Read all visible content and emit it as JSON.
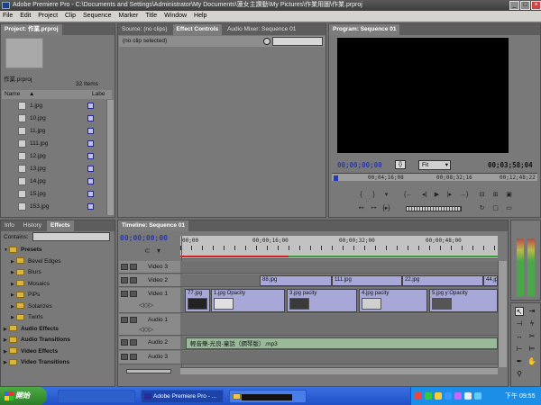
{
  "window": {
    "title": "Adobe Premiere Pro - C:\\Documents and Settings\\Administrator\\My Documents\\蓮女主讚動\\My Pictures\\作業用圖\\作業.prproj",
    "buttons": [
      "_",
      "□",
      "×"
    ]
  },
  "menu": [
    "File",
    "Edit",
    "Project",
    "Clip",
    "Sequence",
    "Marker",
    "Title",
    "Window",
    "Help"
  ],
  "project_panel": {
    "tab": "Project: 作業.prproj",
    "project_name": "作業.prproj",
    "item_count": "32 Items",
    "col_name": "Name",
    "col_label": "Labe",
    "files": [
      "1.jpg",
      "10.jpg",
      "11.jpg",
      "111.jpg",
      "12.jpg",
      "13.jpg",
      "14.jpg",
      "15.jpg",
      "153.jpg"
    ]
  },
  "effect_controls": {
    "tabs": [
      "Source: (no clips)",
      "Effect Controls",
      "Audio Mixer: Sequence 01"
    ],
    "no_clip_text": "(no clip selected)"
  },
  "program_monitor": {
    "tab": "Program: Sequence 01",
    "timecode_current": "00;00;00;00",
    "fit_label": "Fit",
    "timecode_duration": "00;03;58;04",
    "ruler_marks": [
      "00;04;16;08",
      "00;08;32;16",
      "00;12;48;22"
    ]
  },
  "effects_panel": {
    "tabs": [
      "Info",
      "History",
      "Effects"
    ],
    "contains_label": "Contains:",
    "folders": [
      {
        "name": "Presets",
        "level": 0
      },
      {
        "name": "Bevel Edges",
        "level": 1
      },
      {
        "name": "Blurs",
        "level": 1
      },
      {
        "name": "Mosaics",
        "level": 1
      },
      {
        "name": "PiPs",
        "level": 1
      },
      {
        "name": "Solarizes",
        "level": 1
      },
      {
        "name": "Twirls",
        "level": 1
      },
      {
        "name": "Audio Effects",
        "level": 0
      },
      {
        "name": "Audio Transitions",
        "level": 0
      },
      {
        "name": "Video Effects",
        "level": 0
      },
      {
        "name": "Video Transitions",
        "level": 0
      }
    ]
  },
  "timeline": {
    "tab": "Timeline: Sequence 01",
    "timecode": "00;00;00;00",
    "ruler": [
      "00;00",
      "00;00;16;00",
      "00;00;32;00",
      "00;00;48;00"
    ],
    "tracks": [
      "Video 3",
      "Video 2",
      "Video 1",
      "Audio 1",
      "Audio 2",
      "Audio 3"
    ],
    "video2_clips": [
      "88.jpg",
      "111.jpg",
      "22.jpg",
      "44.jpg"
    ],
    "video1_clips": [
      "77.jpg",
      "1.jpg Opacity",
      "3.jpg pacity",
      "4.jpg pacity",
      "5.jpg y:Opacity"
    ],
    "audio2_clip": "輕音樂-光良-童話（鋼琴版）.mp3"
  },
  "taskbar": {
    "start_label": "開始",
    "tasks": [
      "Adobe Premiere Pro - ...",
      ""
    ],
    "clock": "下午 09:55"
  }
}
